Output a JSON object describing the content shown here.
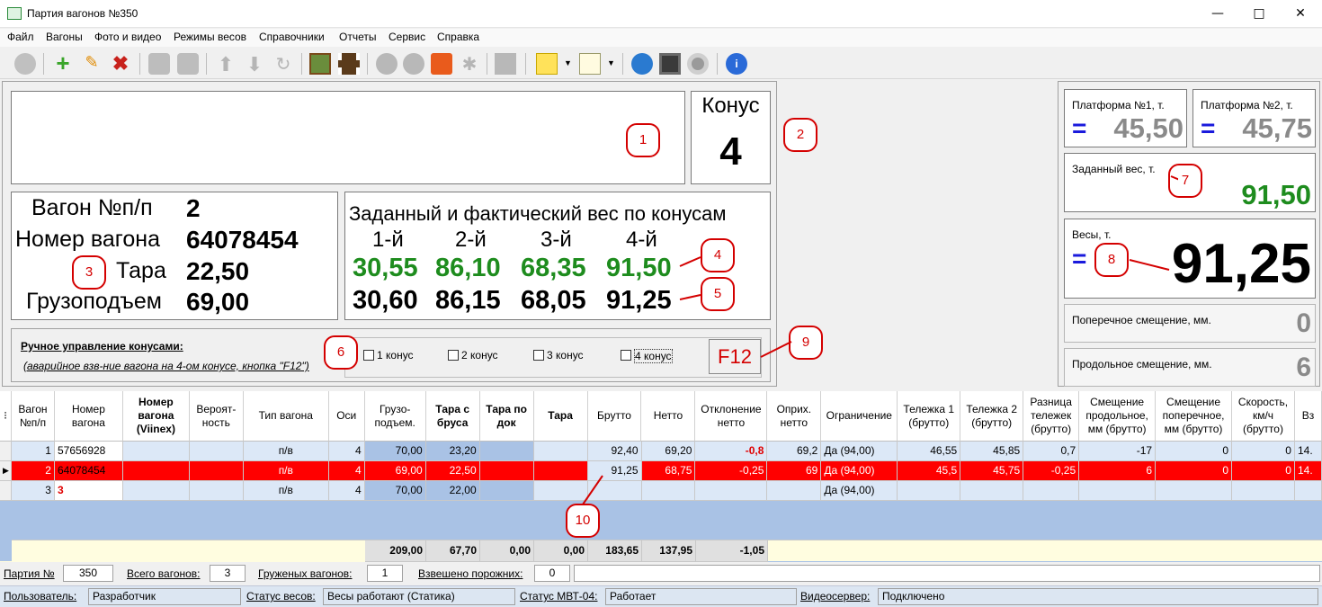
{
  "window": {
    "title": "Партия вагонов №350"
  },
  "menu": [
    "Файл",
    "Вагоны",
    "Фото и видео",
    "Режимы весов",
    "Справочники",
    "Отчеты",
    "Сервис",
    "Справка"
  ],
  "cone": {
    "label": "Конус",
    "value": "4"
  },
  "wagon": {
    "num_label": "Вагон №п/п",
    "num": "2",
    "number_label": "Номер вагона",
    "number": "64078454",
    "tare_label": "Тара",
    "tare": "22,50",
    "cap_label": "Грузоподъем",
    "cap": "69,00"
  },
  "cones": {
    "title": "Заданный и фактический вес по конусам",
    "headers": [
      "1-й",
      "2-й",
      "3-й",
      "4-й"
    ],
    "target": [
      "30,55",
      "86,10",
      "68,35",
      "91,50"
    ],
    "actual": [
      "30,60",
      "86,15",
      "68,05",
      "91,25"
    ]
  },
  "manual": {
    "title": "Ручное управление конусами:",
    "note": "(аварийное взв-ние вагона на 4-ом конусе, кнопка \"F12\")",
    "checks": [
      "1 конус",
      "2 конус",
      "3 конус",
      "4 конус"
    ],
    "f12": "F12"
  },
  "badges": [
    "1",
    "2",
    "3",
    "4",
    "5",
    "6",
    "7",
    "8",
    "9",
    "10"
  ],
  "right": {
    "p1_label": "Платформа №1, т.",
    "p1_val": "45,50",
    "p2_label": "Платформа №2, т.",
    "p2_val": "45,75",
    "eq": "=",
    "target_label": "Заданный вес, т.",
    "target_val": "91,50",
    "scale_label": "Весы, т.",
    "scale_val": "91,25",
    "lat_label": "Поперечное смещение, мм.",
    "lat_val": "0",
    "long_label": "Продольное смещение, мм.",
    "long_val": "6"
  },
  "grid": {
    "headers": [
      "Вагон №п/п",
      "Номер вагона",
      "Номер вагона (Viinex)",
      "Вероят-ность",
      "Тип вагона",
      "Оси",
      "Грузо-подъем.",
      "Тара с бруса",
      "Тара по док",
      "Тара",
      "Брутто",
      "Нетто",
      "Отклонение нетто",
      "Оприх. нетто",
      "Ограничение",
      "Тележка 1 (брутто)",
      "Тележка 2 (брутто)",
      "Разница тележек (брутто)",
      "Смещение продольное, мм (брутто)",
      "Смещение поперечное, мм (брутто)",
      "Скорость, км/ч (брутто)",
      "Вз"
    ],
    "rows": [
      [
        "1",
        "57656928",
        "",
        "",
        "п/в",
        "4",
        "70,00",
        "23,20",
        "",
        "",
        "92,40",
        "69,20",
        "-0,8",
        "69,2",
        "Да (94,00)",
        "46,55",
        "45,85",
        "0,7",
        "-17",
        "0",
        "0",
        "14."
      ],
      [
        "2",
        "64078454",
        "",
        "",
        "п/в",
        "4",
        "69,00",
        "22,50",
        "",
        "",
        "91,25",
        "68,75",
        "-0,25",
        "69",
        "Да (94,00)",
        "45,5",
        "45,75",
        "-0,25",
        "6",
        "0",
        "0",
        "14."
      ],
      [
        "3",
        "3",
        "",
        "",
        "п/в",
        "4",
        "70,00",
        "22,00",
        "",
        "",
        "",
        "",
        "",
        "",
        "Да (94,00)",
        "",
        "",
        "",
        "",
        "",
        "",
        ""
      ]
    ],
    "totals": [
      "209,00",
      "67,70",
      "0,00",
      "0,00",
      "183,65",
      "137,95",
      "-1,05"
    ]
  },
  "status1": {
    "party_label": "Партия №",
    "party": "350",
    "total_label": "Всего вагонов:",
    "total": "3",
    "loaded_label": "Груженых вагонов:",
    "loaded": "1",
    "empty_label": "Взвешено порожних:",
    "empty": "0"
  },
  "status2": {
    "user_label": "Пользователь:",
    "user": "Разработчик",
    "scale_label": "Статус весов:",
    "scale": "Весы работают (Статика)",
    "mvt_label": "Статус МВТ-04:",
    "mvt": "Работает",
    "video_label": "Видеосервер:",
    "video": "Подключено"
  }
}
